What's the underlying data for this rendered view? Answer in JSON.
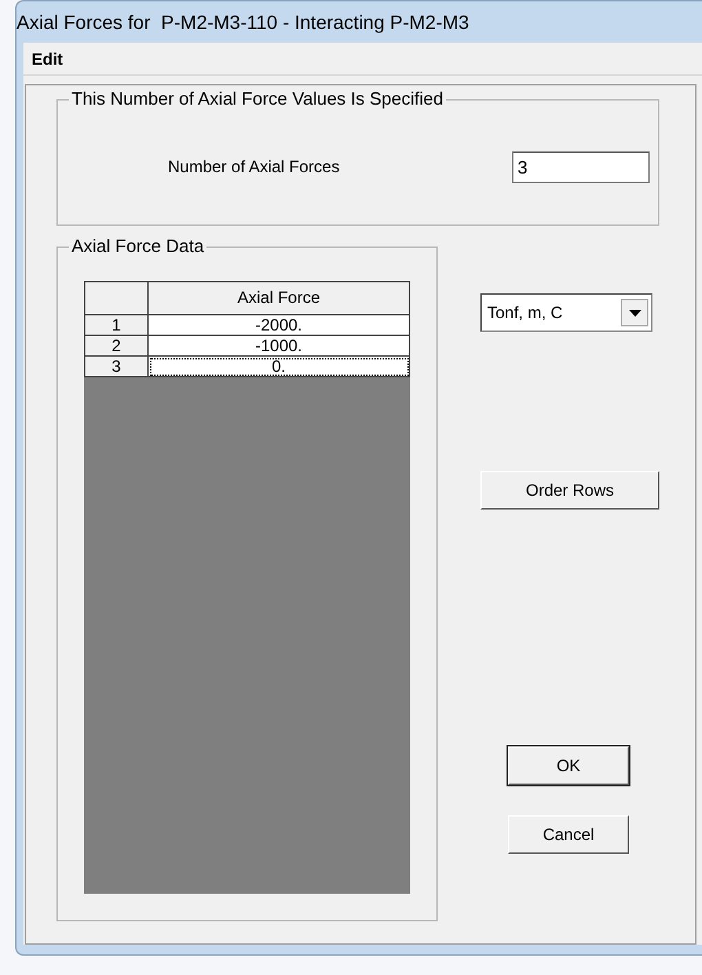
{
  "window": {
    "title": "Axial Forces for  P-M2-M3-110 - Interacting P-M2-M3"
  },
  "menu": [
    {
      "label": "Edit"
    }
  ],
  "count_group": {
    "title": "This Number of Axial Force Values Is Specified",
    "label": "Number of Axial Forces",
    "value": "3"
  },
  "data_group": {
    "title": "Axial Force Data",
    "table": {
      "columns": [
        "Axial Force"
      ],
      "rows": [
        {
          "index": "1",
          "value": "-2000.",
          "selected": false
        },
        {
          "index": "2",
          "value": "-1000.",
          "selected": false
        },
        {
          "index": "3",
          "value": "0.",
          "selected": true
        }
      ]
    }
  },
  "units": {
    "value": "Tonf, m, C"
  },
  "buttons": [
    {
      "label": "Order Rows",
      "default": false
    },
    {
      "label": "OK",
      "default": true
    },
    {
      "label": "Cancel",
      "default": false
    }
  ]
}
